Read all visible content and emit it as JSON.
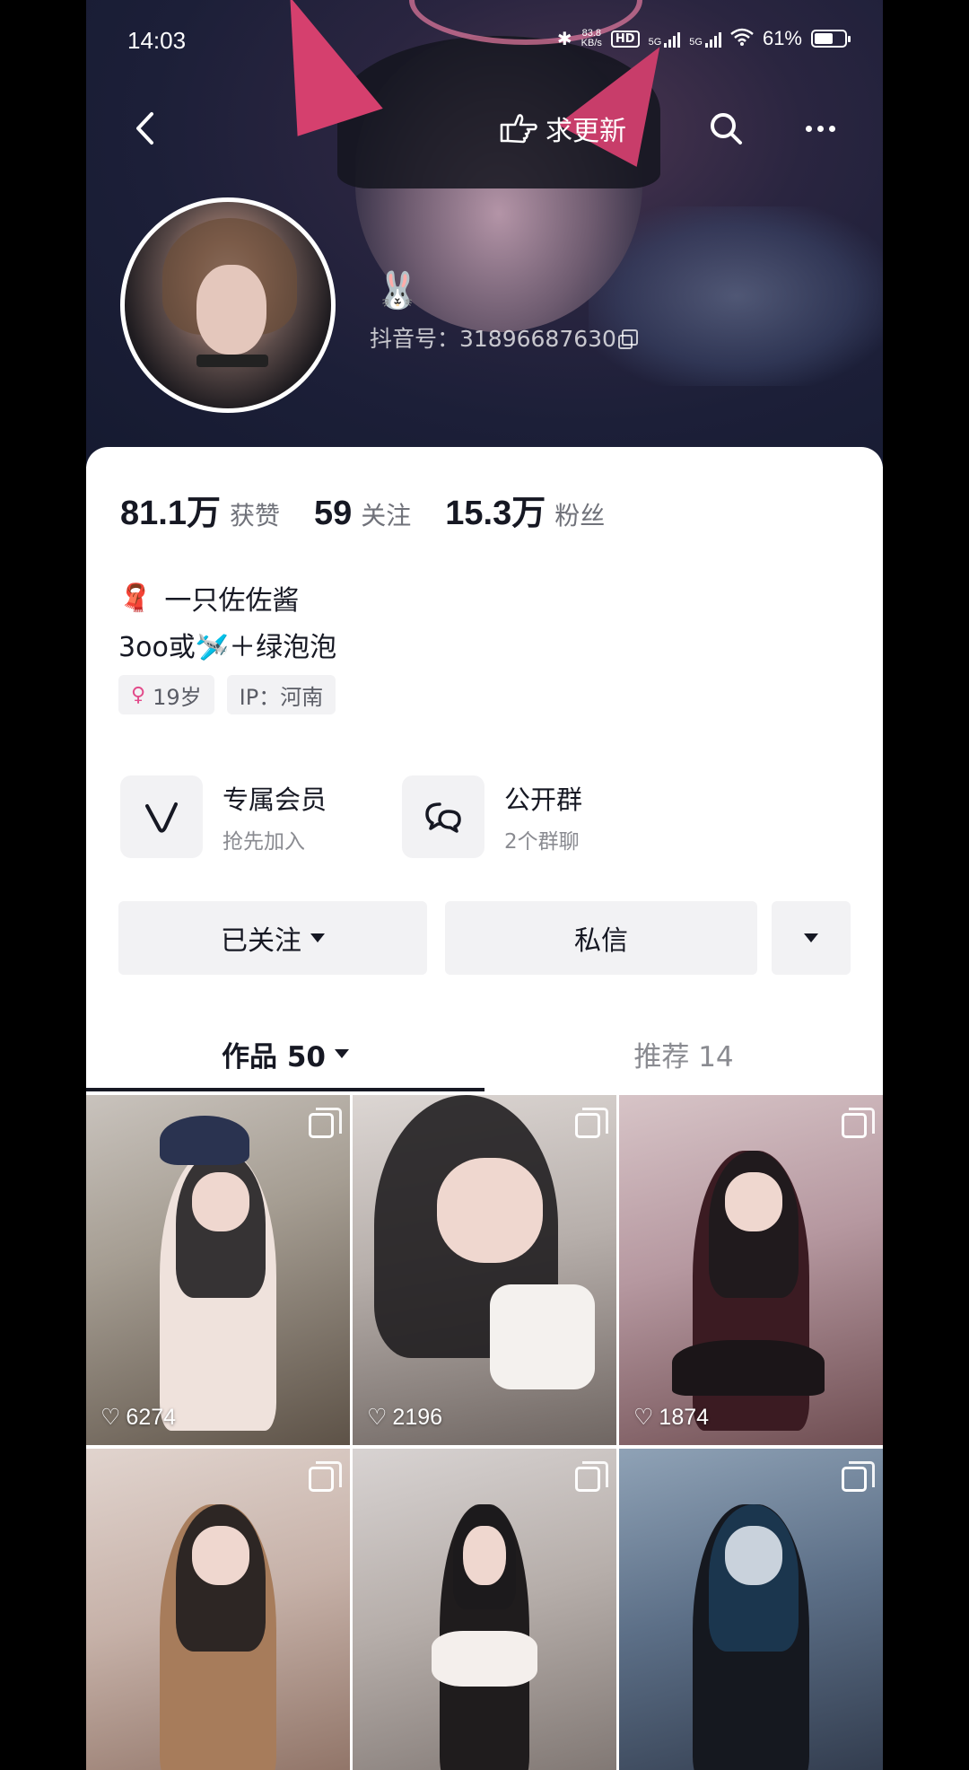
{
  "status_bar": {
    "time": "14:03",
    "network_speed_value": "83.8",
    "network_speed_unit": "KB/s",
    "hd_badge": "HD",
    "sim1": "5G",
    "sim2": "5G",
    "battery_percent": "61%",
    "battery_level": 0.61
  },
  "nav": {
    "request_update_label": "求更新"
  },
  "profile": {
    "emoji": "🐰",
    "douyin_id": "抖音号：31896687630",
    "stats": [
      {
        "number": "81.1万",
        "label": "获赞"
      },
      {
        "number": "59",
        "label": "关注"
      },
      {
        "number": "15.3万",
        "label": "粉丝"
      }
    ],
    "name_emoji": "🧣",
    "name": "一只佐佐酱",
    "bio": "3oo或🛩️＋绿泡泡",
    "tags": {
      "age": "19岁",
      "ip": "IP：河南"
    }
  },
  "features": {
    "member_title": "专属会员",
    "member_sub": "抢先加入",
    "group_title": "公开群",
    "group_sub": "2个群聊"
  },
  "actions": {
    "followed_label": "已关注",
    "message_label": "私信"
  },
  "tabs": {
    "works_label": "作品 50",
    "recommend_label": "推荐 14"
  },
  "videos": [
    {
      "likes": "6274"
    },
    {
      "likes": "2196"
    },
    {
      "likes": "1874"
    },
    {
      "likes": ""
    },
    {
      "likes": ""
    },
    {
      "likes": ""
    }
  ],
  "colors": {
    "accent_dark": "#161823",
    "secondary_text": "#8a8b91",
    "button_bg": "#f2f2f4",
    "gender_pink": "#e24b8a"
  }
}
